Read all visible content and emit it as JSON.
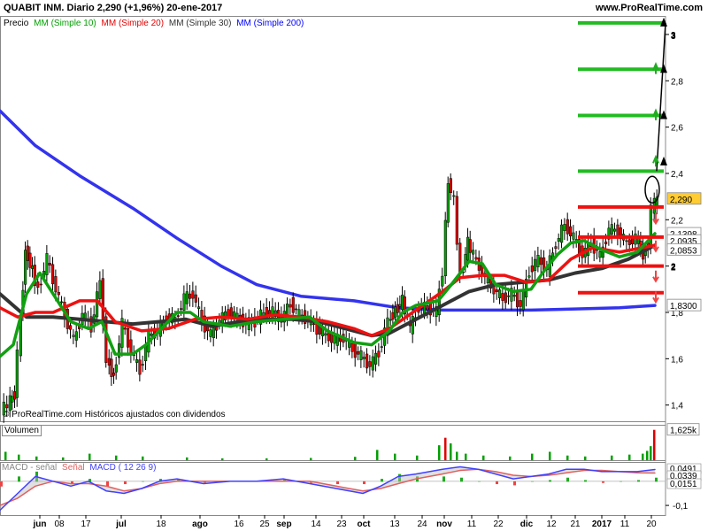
{
  "header": {
    "ticker_line": "QUABIT INM.   Diario    2,290 (+1,96%)    20-ene-2017",
    "site": "www.ProRealTime.com"
  },
  "chart_data": [
    {
      "type": "candlestick",
      "panel": "price",
      "legend": [
        {
          "label": "Precio",
          "color": "#000000"
        },
        {
          "label": "MM (Simple 10)",
          "color": "#00a000"
        },
        {
          "label": "MM (Simple 20)",
          "color": "#e00000"
        },
        {
          "label": "MM (Simple 30)",
          "color": "#333333"
        },
        {
          "label": "MM (Simple 200)",
          "color": "#0000ff"
        }
      ],
      "watermark": "© ProRealTime.com  Históricos ajustados con dividendos",
      "ylim": [
        1.33,
        3.08
      ],
      "y_ticks": [
        "1,4",
        "1,6",
        "1,8",
        "2",
        "2,2",
        "2,4",
        "2,6",
        "2,8",
        "3"
      ],
      "price_tags": [
        {
          "text": "2,290",
          "value": 2.29,
          "bg": "#ffcc33",
          "fg": "#000000"
        },
        {
          "text": "2,1398",
          "value": 2.1398,
          "bg": "#ffffff",
          "fg": "#00a000"
        },
        {
          "text": "2,0935",
          "value": 2.0935,
          "bg": "#ffffff",
          "fg": "#333333"
        },
        {
          "text": "2,0853",
          "value": 2.0853,
          "bg": "#ffffff",
          "fg": "#e00000"
        },
        {
          "text": "1,8300",
          "value": 1.83,
          "bg": "#ffffff",
          "fg": "#0000ff"
        }
      ],
      "green_levels": [
        3.05,
        2.85,
        2.65,
        2.41
      ],
      "red_levels": [
        2.255,
        2.125,
        2.0,
        1.885
      ],
      "ma200": [
        [
          0,
          2.67
        ],
        [
          40,
          2.52
        ],
        [
          90,
          2.39
        ],
        [
          150,
          2.25
        ],
        [
          200,
          2.12
        ],
        [
          250,
          2.0
        ],
        [
          290,
          1.92
        ],
        [
          340,
          1.87
        ],
        [
          400,
          1.85
        ],
        [
          450,
          1.82
        ],
        [
          500,
          1.81
        ],
        [
          600,
          1.81
        ],
        [
          650,
          1.815
        ],
        [
          700,
          1.82
        ],
        [
          740,
          1.83
        ]
      ],
      "ma30": [
        [
          0,
          1.88
        ],
        [
          30,
          1.78
        ],
        [
          60,
          1.78
        ],
        [
          90,
          1.77
        ],
        [
          120,
          1.76
        ],
        [
          150,
          1.75
        ],
        [
          180,
          1.76
        ],
        [
          210,
          1.77
        ],
        [
          240,
          1.74
        ],
        [
          270,
          1.76
        ],
        [
          300,
          1.77
        ],
        [
          330,
          1.77
        ],
        [
          360,
          1.76
        ],
        [
          390,
          1.73
        ],
        [
          420,
          1.7
        ],
        [
          440,
          1.71
        ],
        [
          470,
          1.77
        ],
        [
          500,
          1.83
        ],
        [
          530,
          1.89
        ],
        [
          560,
          1.92
        ],
        [
          590,
          1.93
        ],
        [
          620,
          1.94
        ],
        [
          650,
          1.97
        ],
        [
          680,
          1.99
        ],
        [
          710,
          2.03
        ],
        [
          740,
          2.09
        ]
      ],
      "ma20": [
        [
          0,
          1.82
        ],
        [
          20,
          1.78
        ],
        [
          40,
          1.8
        ],
        [
          60,
          1.8
        ],
        [
          90,
          1.85
        ],
        [
          110,
          1.85
        ],
        [
          130,
          1.76
        ],
        [
          160,
          1.72
        ],
        [
          190,
          1.73
        ],
        [
          220,
          1.77
        ],
        [
          250,
          1.78
        ],
        [
          280,
          1.77
        ],
        [
          310,
          1.79
        ],
        [
          340,
          1.78
        ],
        [
          370,
          1.76
        ],
        [
          400,
          1.73
        ],
        [
          420,
          1.7
        ],
        [
          440,
          1.73
        ],
        [
          470,
          1.81
        ],
        [
          500,
          1.89
        ],
        [
          520,
          1.95
        ],
        [
          545,
          1.96
        ],
        [
          570,
          1.96
        ],
        [
          595,
          1.93
        ],
        [
          620,
          1.94
        ],
        [
          645,
          2.03
        ],
        [
          670,
          2.08
        ],
        [
          700,
          2.06
        ],
        [
          740,
          2.09
        ]
      ],
      "ma10": [
        [
          0,
          1.61
        ],
        [
          15,
          1.66
        ],
        [
          30,
          1.88
        ],
        [
          45,
          1.97
        ],
        [
          60,
          1.88
        ],
        [
          80,
          1.76
        ],
        [
          100,
          1.73
        ],
        [
          115,
          1.76
        ],
        [
          130,
          1.62
        ],
        [
          150,
          1.62
        ],
        [
          165,
          1.66
        ],
        [
          180,
          1.72
        ],
        [
          200,
          1.8
        ],
        [
          215,
          1.8
        ],
        [
          230,
          1.76
        ],
        [
          260,
          1.74
        ],
        [
          290,
          1.76
        ],
        [
          320,
          1.77
        ],
        [
          350,
          1.78
        ],
        [
          370,
          1.72
        ],
        [
          400,
          1.67
        ],
        [
          420,
          1.66
        ],
        [
          440,
          1.72
        ],
        [
          455,
          1.8
        ],
        [
          470,
          1.83
        ],
        [
          495,
          1.85
        ],
        [
          510,
          1.92
        ],
        [
          530,
          2.02
        ],
        [
          545,
          2.01
        ],
        [
          560,
          1.92
        ],
        [
          580,
          1.89
        ],
        [
          600,
          1.9
        ],
        [
          615,
          1.98
        ],
        [
          630,
          2.05
        ],
        [
          645,
          2.1
        ],
        [
          660,
          2.11
        ],
        [
          680,
          2.07
        ],
        [
          700,
          2.04
        ],
        [
          720,
          2.06
        ],
        [
          740,
          2.14
        ]
      ],
      "close": [
        [
          3,
          1.4
        ],
        [
          10,
          1.45
        ],
        [
          18,
          1.62
        ],
        [
          22,
          2.07
        ],
        [
          30,
          1.98
        ],
        [
          38,
          1.9
        ],
        [
          45,
          2.03
        ],
        [
          55,
          1.9
        ],
        [
          65,
          1.79
        ],
        [
          75,
          1.68
        ],
        [
          85,
          1.79
        ],
        [
          95,
          1.74
        ],
        [
          105,
          1.93
        ],
        [
          115,
          1.6
        ],
        [
          122,
          1.52
        ],
        [
          130,
          1.75
        ],
        [
          140,
          1.63
        ],
        [
          150,
          1.55
        ],
        [
          160,
          1.7
        ],
        [
          170,
          1.72
        ],
        [
          180,
          1.78
        ],
        [
          190,
          1.77
        ],
        [
          200,
          1.86
        ],
        [
          210,
          1.88
        ],
        [
          220,
          1.76
        ],
        [
          230,
          1.7
        ],
        [
          240,
          1.77
        ],
        [
          250,
          1.8
        ],
        [
          260,
          1.78
        ],
        [
          270,
          1.75
        ],
        [
          280,
          1.76
        ],
        [
          290,
          1.8
        ],
        [
          300,
          1.8
        ],
        [
          310,
          1.77
        ],
        [
          320,
          1.84
        ],
        [
          330,
          1.79
        ],
        [
          340,
          1.77
        ],
        [
          350,
          1.73
        ],
        [
          360,
          1.7
        ],
        [
          370,
          1.68
        ],
        [
          380,
          1.69
        ],
        [
          390,
          1.64
        ],
        [
          400,
          1.61
        ],
        [
          410,
          1.57
        ],
        [
          420,
          1.63
        ],
        [
          430,
          1.76
        ],
        [
          440,
          1.81
        ],
        [
          448,
          1.85
        ],
        [
          456,
          1.73
        ],
        [
          465,
          1.82
        ],
        [
          475,
          1.82
        ],
        [
          485,
          1.8
        ],
        [
          495,
          1.98
        ],
        [
          502,
          2.37
        ],
        [
          508,
          2.28
        ],
        [
          515,
          1.95
        ],
        [
          522,
          2.1
        ],
        [
          530,
          2.02
        ],
        [
          540,
          1.95
        ],
        [
          550,
          1.9
        ],
        [
          560,
          1.86
        ],
        [
          570,
          1.88
        ],
        [
          580,
          1.83
        ],
        [
          590,
          1.98
        ],
        [
          600,
          2.03
        ],
        [
          610,
          1.98
        ],
        [
          620,
          2.1
        ],
        [
          630,
          2.18
        ],
        [
          640,
          2.12
        ],
        [
          650,
          2.05
        ],
        [
          660,
          2.1
        ],
        [
          670,
          2.04
        ],
        [
          680,
          2.16
        ],
        [
          690,
          2.15
        ],
        [
          700,
          2.1
        ],
        [
          710,
          2.12
        ],
        [
          720,
          2.05
        ],
        [
          728,
          2.1
        ],
        [
          734,
          2.25
        ],
        [
          738,
          2.29
        ]
      ]
    },
    {
      "type": "bar",
      "panel": "volume",
      "label": "Volumen",
      "value_tag": "1,625k",
      "values": [
        [
          5,
          0.45
        ],
        [
          20,
          0.3
        ],
        [
          40,
          0.2
        ],
        [
          70,
          0.15
        ],
        [
          100,
          0.35
        ],
        [
          130,
          0.25
        ],
        [
          160,
          0.2
        ],
        [
          210,
          0.15
        ],
        [
          250,
          0.1
        ],
        [
          300,
          0.1
        ],
        [
          350,
          0.12
        ],
        [
          400,
          0.18
        ],
        [
          425,
          0.55
        ],
        [
          445,
          0.35
        ],
        [
          470,
          0.25
        ],
        [
          495,
          0.8
        ],
        [
          502,
          1.2
        ],
        [
          508,
          0.9
        ],
        [
          515,
          0.45
        ],
        [
          525,
          0.35
        ],
        [
          545,
          0.25
        ],
        [
          575,
          0.2
        ],
        [
          600,
          0.35
        ],
        [
          620,
          0.45
        ],
        [
          640,
          0.25
        ],
        [
          660,
          0.2
        ],
        [
          690,
          0.25
        ],
        [
          710,
          0.3
        ],
        [
          725,
          0.35
        ],
        [
          730,
          0.5
        ],
        [
          734,
          0.75
        ],
        [
          738,
          1.625
        ]
      ]
    },
    {
      "type": "area",
      "panel": "macd",
      "legend": [
        {
          "label": "MACD - señal",
          "color": "#cccccc"
        },
        {
          "label": "Señal",
          "color": "#e06060"
        },
        {
          "label": "MACD ( 12 26 9)",
          "color": "#4040ff"
        }
      ],
      "y_ticks": [
        "-0,1"
      ],
      "tags": [
        {
          "text": "0,0491",
          "fg": "#4040ff"
        },
        {
          "text": "0,0339",
          "fg": "#e06060"
        },
        {
          "text": "0,0151",
          "fg": "#00a000"
        }
      ],
      "macd": [
        [
          0,
          -0.12
        ],
        [
          20,
          -0.05
        ],
        [
          40,
          0.02
        ],
        [
          60,
          0.0
        ],
        [
          80,
          -0.02
        ],
        [
          100,
          0.0
        ],
        [
          120,
          -0.04
        ],
        [
          140,
          -0.05
        ],
        [
          160,
          -0.03
        ],
        [
          180,
          0.0
        ],
        [
          200,
          0.01
        ],
        [
          230,
          -0.01
        ],
        [
          260,
          0.0
        ],
        [
          290,
          0.0
        ],
        [
          320,
          0.01
        ],
        [
          350,
          -0.01
        ],
        [
          380,
          -0.03
        ],
        [
          410,
          -0.05
        ],
        [
          430,
          -0.02
        ],
        [
          450,
          0.02
        ],
        [
          470,
          0.03
        ],
        [
          500,
          0.05
        ],
        [
          520,
          0.06
        ],
        [
          540,
          0.05
        ],
        [
          560,
          0.03
        ],
        [
          580,
          0.01
        ],
        [
          600,
          0.02
        ],
        [
          620,
          0.03
        ],
        [
          640,
          0.05
        ],
        [
          660,
          0.05
        ],
        [
          680,
          0.04
        ],
        [
          700,
          0.04
        ],
        [
          720,
          0.04
        ],
        [
          740,
          0.049
        ]
      ],
      "signal": [
        [
          0,
          -0.1
        ],
        [
          20,
          -0.07
        ],
        [
          40,
          -0.02
        ],
        [
          60,
          0.0
        ],
        [
          80,
          -0.01
        ],
        [
          100,
          -0.01
        ],
        [
          120,
          -0.02
        ],
        [
          140,
          -0.04
        ],
        [
          160,
          -0.03
        ],
        [
          180,
          -0.01
        ],
        [
          200,
          0.0
        ],
        [
          230,
          0.0
        ],
        [
          260,
          0.0
        ],
        [
          290,
          0.0
        ],
        [
          320,
          0.0
        ],
        [
          350,
          0.0
        ],
        [
          380,
          -0.02
        ],
        [
          410,
          -0.04
        ],
        [
          430,
          -0.03
        ],
        [
          450,
          -0.01
        ],
        [
          470,
          0.01
        ],
        [
          500,
          0.03
        ],
        [
          520,
          0.045
        ],
        [
          540,
          0.05
        ],
        [
          560,
          0.04
        ],
        [
          580,
          0.025
        ],
        [
          600,
          0.02
        ],
        [
          620,
          0.025
        ],
        [
          640,
          0.035
        ],
        [
          660,
          0.045
        ],
        [
          680,
          0.045
        ],
        [
          700,
          0.04
        ],
        [
          720,
          0.035
        ],
        [
          740,
          0.034
        ]
      ],
      "ylim": [
        -0.14,
        0.08
      ]
    }
  ],
  "x_axis": {
    "ticks": [
      {
        "label": "jun",
        "x": 45,
        "bold": true
      },
      {
        "label": "08",
        "x": 67,
        "bold": false
      },
      {
        "label": "17",
        "x": 97,
        "bold": false
      },
      {
        "label": "jul",
        "x": 137,
        "bold": true
      },
      {
        "label": "18",
        "x": 182,
        "bold": false
      },
      {
        "label": "ago",
        "x": 226,
        "bold": true
      },
      {
        "label": "16",
        "x": 270,
        "bold": false
      },
      {
        "label": "25",
        "x": 299,
        "bold": false
      },
      {
        "label": "sep",
        "x": 321,
        "bold": true
      },
      {
        "label": "14",
        "x": 357,
        "bold": false
      },
      {
        "label": "23",
        "x": 386,
        "bold": false
      },
      {
        "label": "oct",
        "x": 411,
        "bold": true
      },
      {
        "label": "13",
        "x": 446,
        "bold": false
      },
      {
        "label": "24",
        "x": 477,
        "bold": false
      },
      {
        "label": "nov",
        "x": 502,
        "bold": true
      },
      {
        "label": "11",
        "x": 533,
        "bold": false
      },
      {
        "label": "22",
        "x": 563,
        "bold": false
      },
      {
        "label": "dic",
        "x": 595,
        "bold": true
      },
      {
        "label": "12",
        "x": 623,
        "bold": false
      },
      {
        "label": "21",
        "x": 650,
        "bold": false
      },
      {
        "label": "2017",
        "x": 680,
        "bold": true
      },
      {
        "label": "11",
        "x": 706,
        "bold": false
      },
      {
        "label": "20",
        "x": 736,
        "bold": false
      }
    ]
  },
  "colors": {
    "up": "#00a000",
    "down": "#e00000",
    "ma200": "#3333ee",
    "ma30": "#333333",
    "ma20": "#ee1111",
    "ma10": "#11a011",
    "arrow_up": "#22aa22",
    "arrow_down": "#ee4444"
  },
  "annotations": [
    {
      "text": "3",
      "value": 3.0
    },
    {
      "text": "2",
      "value": 2.0
    }
  ]
}
